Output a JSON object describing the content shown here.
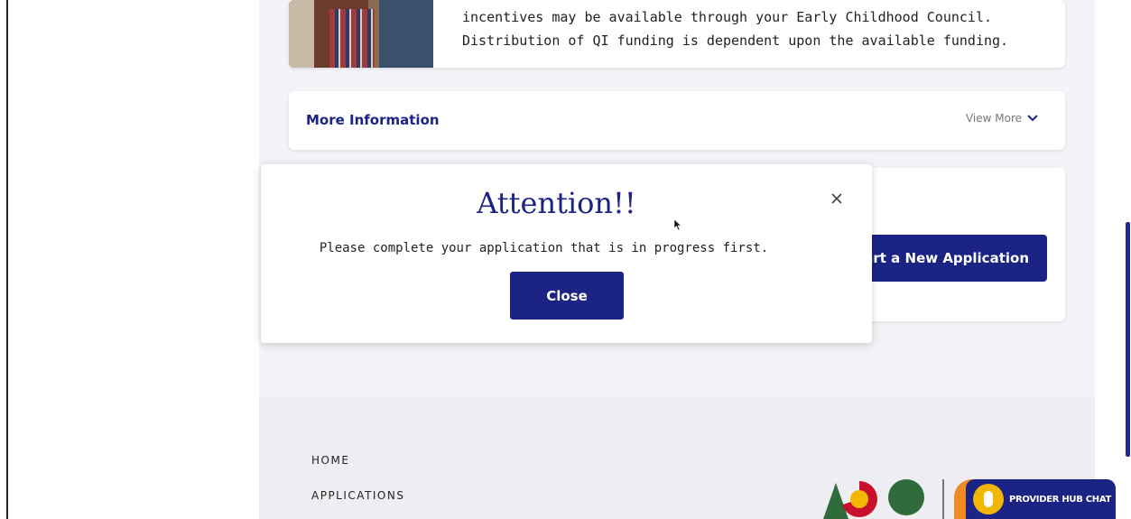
{
  "info_card": {
    "text": "incentives may be available through your Early Childhood Council. Distribution of QI funding is dependent upon the available funding."
  },
  "more_info": {
    "title": "More Information",
    "toggle_label": "View More"
  },
  "start_card": {
    "button_label": "Start a New Application"
  },
  "modal": {
    "title": "Attention!!",
    "message": "Please complete your application that is in progress first.",
    "close_label": "Close"
  },
  "footer": {
    "links": [
      "HOME",
      "APPLICATIONS"
    ]
  },
  "chat": {
    "label": "PROVIDER HUB CHAT"
  },
  "colors": {
    "primary": "#1b2385",
    "page_bg": "#f3f4f8",
    "footer_bg": "#eeeef2"
  }
}
